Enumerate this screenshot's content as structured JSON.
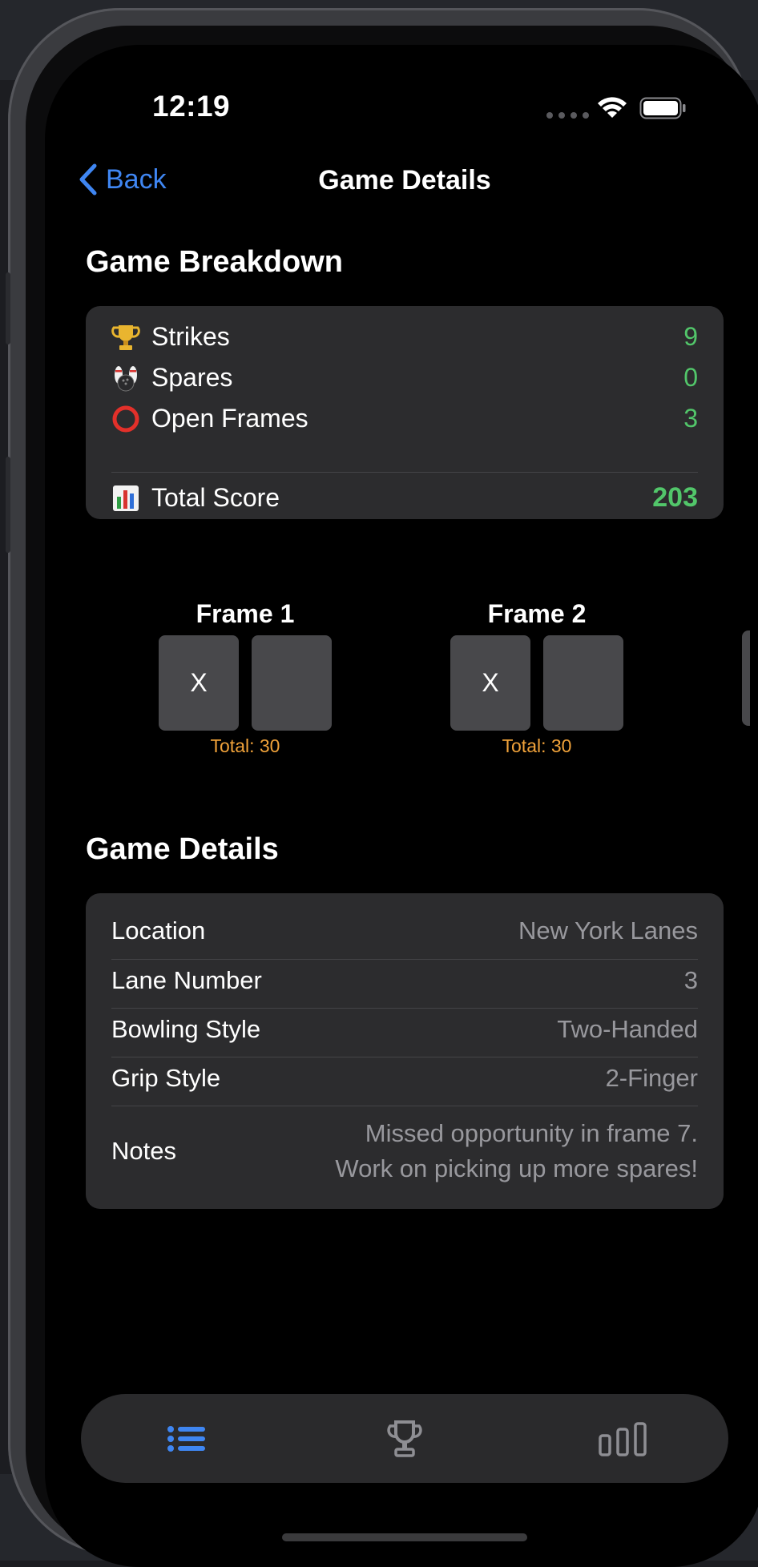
{
  "status_bar": {
    "time": "12:19"
  },
  "nav": {
    "back_label": "Back",
    "title": "Game Details"
  },
  "breakdown": {
    "title": "Game Breakdown",
    "rows": [
      {
        "icon": "trophy-icon",
        "label": "Strikes",
        "value": "9"
      },
      {
        "icon": "bowling-pins-icon",
        "label": "Spares",
        "value": "0"
      },
      {
        "icon": "red-circle-icon",
        "label": "Open Frames",
        "value": "3"
      }
    ],
    "total": {
      "icon": "bar-chart-icon",
      "label": "Total Score",
      "value": "203"
    }
  },
  "frames": [
    {
      "title": "Frame 1",
      "balls": [
        "X",
        ""
      ],
      "total": "Total: 30"
    },
    {
      "title": "Frame 2",
      "balls": [
        "X",
        ""
      ],
      "total": "Total: 30"
    }
  ],
  "details": {
    "title": "Game Details",
    "rows": [
      {
        "label": "Location",
        "value": "New York Lanes"
      },
      {
        "label": "Lane Number",
        "value": "3"
      },
      {
        "label": "Bowling Style",
        "value": "Two-Handed"
      },
      {
        "label": "Grip Style",
        "value": "2-Finger"
      }
    ],
    "notes": {
      "label": "Notes",
      "line1": "Missed opportunity in frame 7.",
      "line2": "Work on picking up more spares!"
    }
  },
  "tabbar": {
    "tabs": [
      {
        "icon": "list-icon",
        "selected": true
      },
      {
        "icon": "trophy-outline-icon",
        "selected": false
      },
      {
        "icon": "bar-chart-outline-icon",
        "selected": false
      }
    ]
  },
  "colors": {
    "accent": "#3f86f2",
    "positive": "#52c66a",
    "frame_total": "#f0a23a",
    "card": "#2c2c2e",
    "secondary_text": "#98989d"
  }
}
